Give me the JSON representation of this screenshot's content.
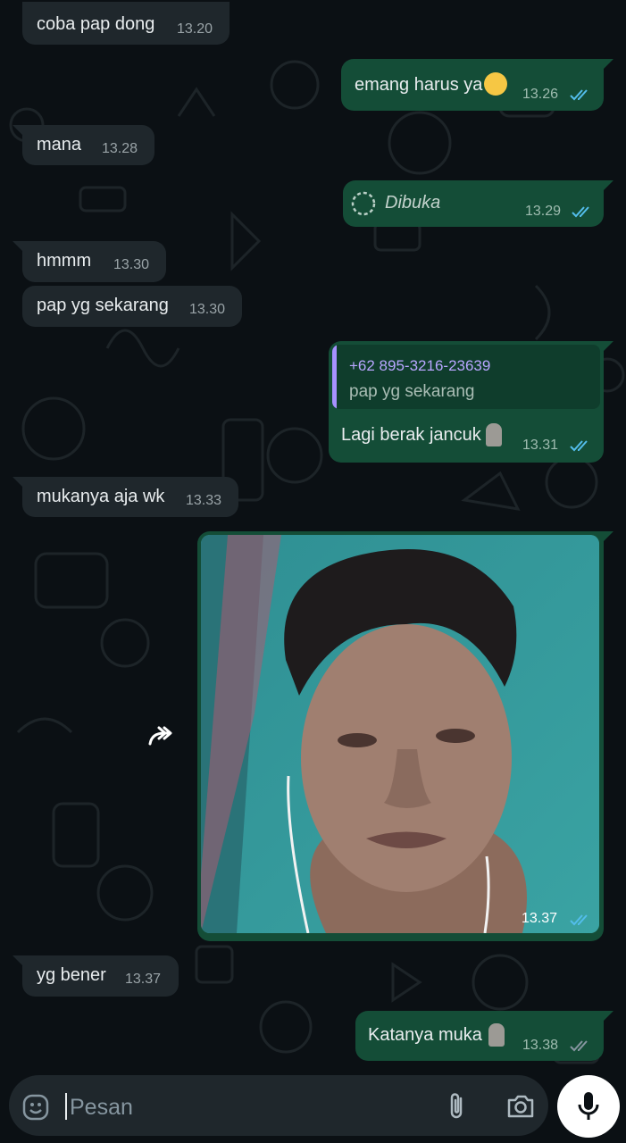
{
  "messages": [
    {
      "text": "coba pap dong",
      "time": "13.20"
    },
    {
      "text": "emang harus ya",
      "time": "13.26"
    },
    {
      "text": "mana",
      "time": "13.28"
    },
    {
      "text": "Dibuka",
      "time": "13.29"
    },
    {
      "text": "hmmm",
      "time": "13.30"
    },
    {
      "text": "pap yg sekarang",
      "time": "13.30"
    },
    {
      "quoted_sender": "+62 895-3216-23639",
      "quoted_text": "pap yg sekarang",
      "text": "Lagi berak jancuk",
      "time": "13.31"
    },
    {
      "text": "mukanya aja wk",
      "time": "13.33"
    },
    {
      "time": "13.37"
    },
    {
      "text": "yg bener",
      "time": "13.37"
    },
    {
      "text": "Katanya muka",
      "time": "13.38"
    }
  ],
  "composer": {
    "placeholder": "Pesan"
  },
  "icons": [
    "emoji-icon",
    "attach-icon",
    "camera-icon",
    "mic-icon",
    "forward-icon",
    "double-check-icon",
    "view-once-icon"
  ],
  "colors": {
    "incoming": "#1f272c",
    "outgoing": "#144d37",
    "read_ticks": "#53bdeb",
    "sent_ticks": "#8696a0"
  }
}
